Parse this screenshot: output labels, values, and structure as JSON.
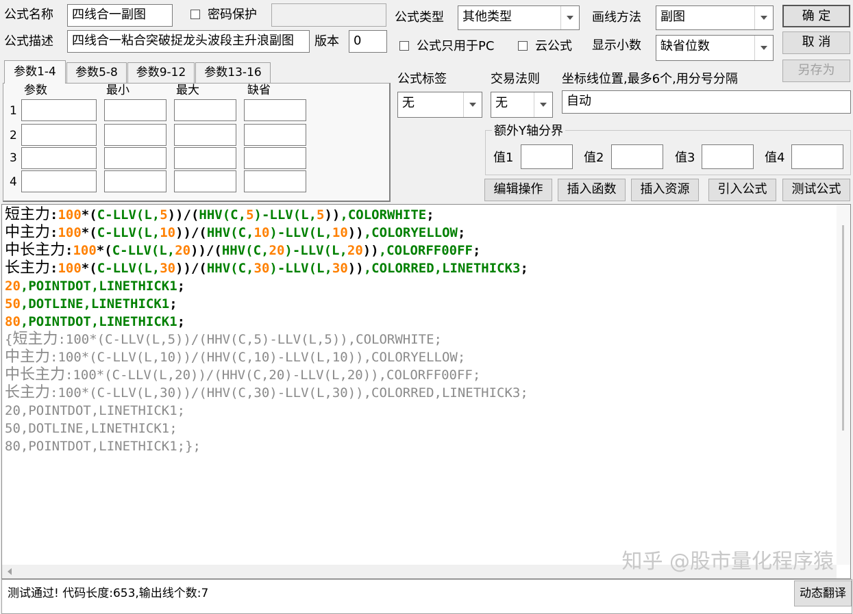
{
  "header": {
    "formula_name_label": "公式名称",
    "formula_name_value": "四线合一副图",
    "password_label": "密码保护",
    "formula_desc_label": "公式描述",
    "formula_desc_value": "四线合一粘合突破捉龙头波段主升浪副图",
    "version_label": "版本",
    "version_value": "0",
    "formula_type_label": "公式类型",
    "formula_type_value": "其他类型",
    "draw_method_label": "画线方法",
    "draw_method_value": "副图",
    "pc_only_label": "公式只用于PC",
    "cloud_label": "云公式",
    "decimals_label": "显示小数",
    "decimals_value": "缺省位数",
    "tag_label": "公式标签",
    "tag_value": "无",
    "trade_rule_label": "交易法则",
    "trade_rule_value": "无",
    "coord_label": "坐标线位置,最多6个,用分号分隔",
    "coord_value": "自动",
    "extra_y_label": "额外Y轴分界",
    "val1": "值1",
    "val2": "值2",
    "val3": "值3",
    "val4": "值4"
  },
  "buttons": {
    "ok": "确  定",
    "cancel": "取  消",
    "save_as": "另存为",
    "edit": "编辑操作",
    "insert_fn": "插入函数",
    "insert_res": "插入资源",
    "import": "引入公式",
    "test": "测试公式",
    "dynamic": "动态翻译"
  },
  "tabs": [
    "参数1-4",
    "参数5-8",
    "参数9-12",
    "参数13-16"
  ],
  "params": {
    "headers": [
      "参数",
      "最小",
      "最大",
      "缺省"
    ],
    "rows": [
      "1",
      "2",
      "3",
      "4"
    ]
  },
  "code": [
    [
      [
        "cn",
        "短主力"
      ],
      [
        "op",
        ":"
      ],
      [
        "num",
        "100"
      ],
      [
        "op",
        "*("
      ],
      [
        "fn",
        "C-LLV(L,"
      ],
      [
        "num",
        "5"
      ],
      [
        "op",
        "))/("
      ],
      [
        "fn",
        "HHV(C,"
      ],
      [
        "num",
        "5"
      ],
      [
        "fn",
        ")-LLV(L,"
      ],
      [
        "num",
        "5"
      ],
      [
        "op",
        "))"
      ],
      [
        "fn",
        ",COLORWHITE"
      ],
      [
        "op",
        ";"
      ]
    ],
    [
      [
        "cn",
        "中主力"
      ],
      [
        "op",
        ":"
      ],
      [
        "num",
        "100"
      ],
      [
        "op",
        "*("
      ],
      [
        "fn",
        "C-LLV(L,"
      ],
      [
        "num",
        "10"
      ],
      [
        "op",
        "))/("
      ],
      [
        "fn",
        "HHV(C,"
      ],
      [
        "num",
        "10"
      ],
      [
        "fn",
        ")-LLV(L,"
      ],
      [
        "num",
        "10"
      ],
      [
        "op",
        "))"
      ],
      [
        "fn",
        ",COLORYELLOW"
      ],
      [
        "op",
        ";"
      ]
    ],
    [
      [
        "cn",
        "中长主力"
      ],
      [
        "op",
        ":"
      ],
      [
        "num",
        "100"
      ],
      [
        "op",
        "*("
      ],
      [
        "fn",
        "C-LLV(L,"
      ],
      [
        "num",
        "20"
      ],
      [
        "op",
        "))/("
      ],
      [
        "fn",
        "HHV(C,"
      ],
      [
        "num",
        "20"
      ],
      [
        "fn",
        ")-LLV(L,"
      ],
      [
        "num",
        "20"
      ],
      [
        "op",
        "))"
      ],
      [
        "fn",
        ",COLORFF00FF"
      ],
      [
        "op",
        ";"
      ]
    ],
    [
      [
        "cn",
        "长主力"
      ],
      [
        "op",
        ":"
      ],
      [
        "num",
        "100"
      ],
      [
        "op",
        "*("
      ],
      [
        "fn",
        "C-LLV(L,"
      ],
      [
        "num",
        "30"
      ],
      [
        "op",
        "))/("
      ],
      [
        "fn",
        "HHV(C,"
      ],
      [
        "num",
        "30"
      ],
      [
        "fn",
        ")-LLV(L,"
      ],
      [
        "num",
        "30"
      ],
      [
        "op",
        "))"
      ],
      [
        "fn",
        ",COLORRED,LINETHICK3"
      ],
      [
        "op",
        ";"
      ]
    ],
    [
      [
        "num",
        "20"
      ],
      [
        "fn",
        ",POINTDOT,LINETHICK1"
      ],
      [
        "op",
        ";"
      ]
    ],
    [
      [
        "num",
        "50"
      ],
      [
        "fn",
        ",DOTLINE,LINETHICK1"
      ],
      [
        "op",
        ";"
      ]
    ],
    [
      [
        "num",
        "80"
      ],
      [
        "fn",
        ",POINTDOT,LINETHICK1"
      ],
      [
        "op",
        ";"
      ]
    ],
    [
      [
        "cm",
        "{"
      ],
      [
        "cmcn",
        "短主力"
      ],
      [
        "cm",
        ":100*(C-LLV(L,5))/(HHV(C,5)-LLV(L,5)),COLORWHITE;"
      ]
    ],
    [
      [
        "cmcn",
        "中主力"
      ],
      [
        "cm",
        ":100*(C-LLV(L,10))/(HHV(C,10)-LLV(L,10)),COLORYELLOW;"
      ]
    ],
    [
      [
        "cmcn",
        "中长主力"
      ],
      [
        "cm",
        ":100*(C-LLV(L,20))/(HHV(C,20)-LLV(L,20)),COLORFF00FF;"
      ]
    ],
    [
      [
        "cmcn",
        "长主力"
      ],
      [
        "cm",
        ":100*(C-LLV(L,30))/(HHV(C,30)-LLV(L,30)),COLORRED,LINETHICK3;"
      ]
    ],
    [
      [
        "cm",
        "20,POINTDOT,LINETHICK1;"
      ]
    ],
    [
      [
        "cm",
        "50,DOTLINE,LINETHICK1;"
      ]
    ],
    [
      [
        "cm",
        "80,POINTDOT,LINETHICK1;};"
      ]
    ]
  ],
  "status": {
    "message": "测试通过! 代码长度:653,输出线个数:7",
    "watermark": "知乎 @股市量化程序猿"
  },
  "colors": {
    "number": "#ff8000",
    "function": "#008000",
    "comment": "#8a8a8a"
  },
  "icons": {
    "dropdown": "chevron-down-icon",
    "scroll_left": "scroll-left-arrow-icon"
  }
}
